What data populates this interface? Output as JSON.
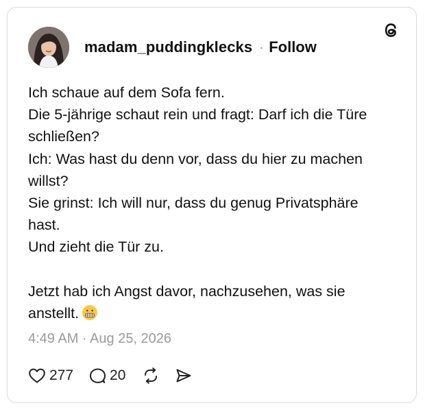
{
  "post": {
    "username": "madam_puddingklecks",
    "separator": "·",
    "follow_label": "Follow",
    "text_lines": [
      "Ich schaue auf dem Sofa fern.",
      "Die 5-jährige schaut rein und fragt: Darf ich die Türe",
      "schließen?",
      "Ich: Was hast du denn vor, dass du hier zu machen",
      "willst?",
      "Sie grinst: Ich will nur, dass du genug Privatsphäre",
      "hast.",
      "Und zieht die Tür zu.",
      "",
      "Jetzt hab ich Angst davor, nachzusehen, was sie",
      "anstellt."
    ],
    "emoji": "grimacing-face-emoji",
    "timestamp": "4:49 AM · Aug 25, 2026",
    "likes": "277",
    "replies": "20"
  },
  "icons": {
    "logo": "threads-logo-icon",
    "like": "heart-icon",
    "reply": "speech-bubble-icon",
    "repost": "repost-icon",
    "share": "send-icon"
  },
  "colors": {
    "text": "#101010",
    "muted": "#9a9a9a",
    "border": "#d9d9d9",
    "emoji": "#f7c948"
  }
}
